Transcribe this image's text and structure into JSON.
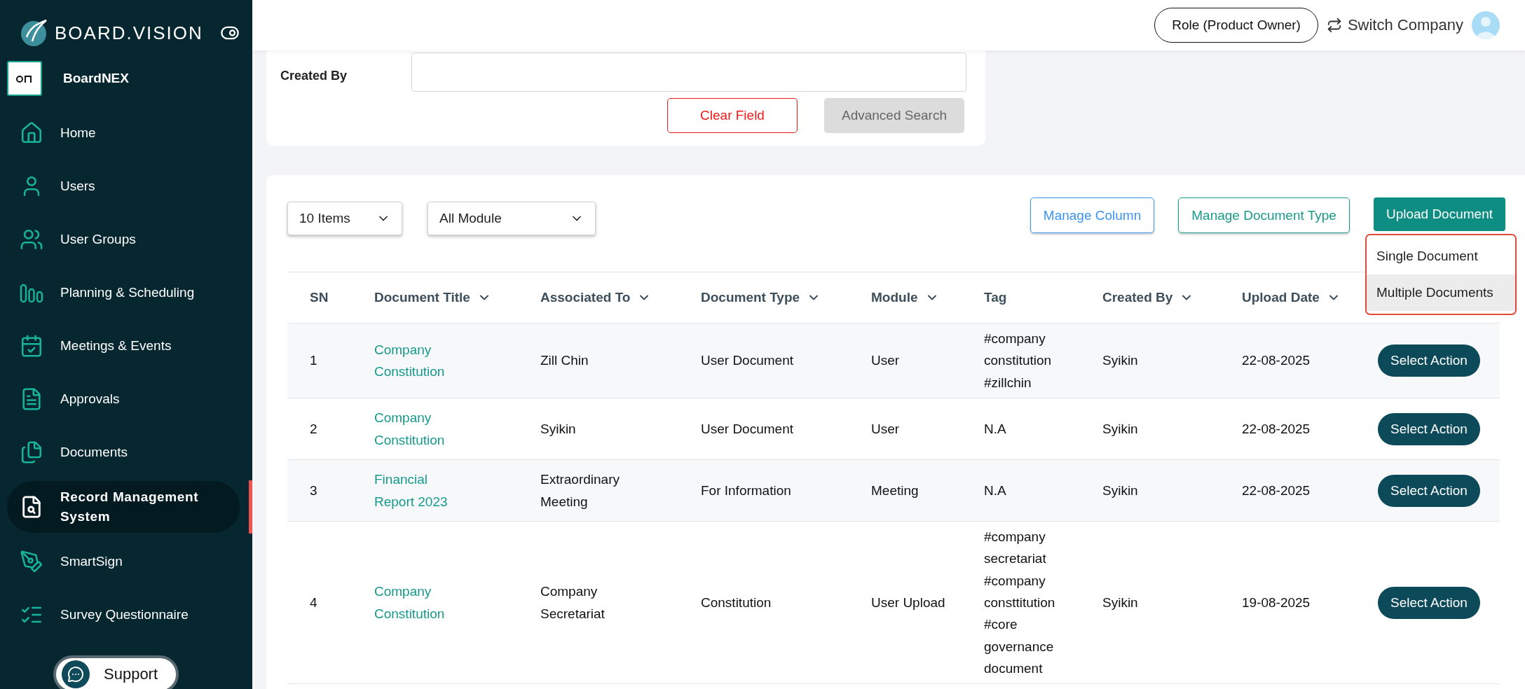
{
  "sidebar": {
    "brand": "BOARD.VISION",
    "company": "BoardNEX",
    "items": [
      {
        "label": "Home",
        "selected": false
      },
      {
        "label": "Users",
        "selected": false
      },
      {
        "label": "User Groups",
        "selected": false
      },
      {
        "label": "Planning & Scheduling",
        "selected": false
      },
      {
        "label": "Meetings & Events",
        "selected": false
      },
      {
        "label": "Approvals",
        "selected": false
      },
      {
        "label": "Documents",
        "selected": false
      },
      {
        "label": "Record Management System",
        "selected": true
      },
      {
        "label": "SmartSign",
        "selected": false
      },
      {
        "label": "Survey Questionnaire",
        "selected": false
      }
    ]
  },
  "support": {
    "label": "Support"
  },
  "header": {
    "role": "Role (Product Owner)",
    "switch": "Switch Company"
  },
  "search_panel": {
    "created_by_label": "Created By",
    "clear_button": "Clear Field",
    "advanced_search_button": {
      "label": "Advanced Search",
      "disabled": true
    }
  },
  "documents": {
    "page_size": "10 Items",
    "module_filter": "All Module",
    "buttons": [
      "Manage Column",
      "Manage Document Type"
    ],
    "upload_button": "Upload Document",
    "upload_menu": [
      {
        "label": "Single Document",
        "highlighted": false
      },
      {
        "label": "Multiple Documents",
        "highlighted": true
      }
    ],
    "table": {
      "columns": [
        {
          "label": "SN",
          "sortable": false
        },
        {
          "label": "Document Title",
          "sortable": true
        },
        {
          "label": "Associated To",
          "sortable": true
        },
        {
          "label": "Document Type",
          "sortable": true
        },
        {
          "label": "Module",
          "sortable": true
        },
        {
          "label": "Tag",
          "sortable": false
        },
        {
          "label": "Created By",
          "sortable": true
        },
        {
          "label": "Upload Date",
          "sortable": true
        }
      ],
      "rows": [
        {
          "sn": "1",
          "title": "Company Constitution",
          "associated_to": "Zill Chin",
          "type": "User Document",
          "module": "User",
          "tag": "#company constitution #zillchin",
          "created_by": "Syikin",
          "upload_date": "22-08-2025",
          "action": "Select Action"
        },
        {
          "sn": "2",
          "title": "Company Constitution",
          "associated_to": "Syikin",
          "type": "User Document",
          "module": "User",
          "tag": "N.A",
          "created_by": "Syikin",
          "upload_date": "22-08-2025",
          "action": "Select Action"
        },
        {
          "sn": "3",
          "title": "Financial Report 2023",
          "associated_to": "Extraordinary Meeting",
          "type": "For Information",
          "module": "Meeting",
          "tag": "N.A",
          "created_by": "Syikin",
          "upload_date": "22-08-2025",
          "action": "Select Action"
        },
        {
          "sn": "4",
          "title": "Company Constitution",
          "associated_to": "Company Secretariat",
          "type": "Constitution",
          "module": "User Upload",
          "tag": "#company secretariat #company consttitution #core governance document",
          "created_by": "Syikin",
          "upload_date": "19-08-2025",
          "action": "Select Action"
        }
      ]
    }
  }
}
